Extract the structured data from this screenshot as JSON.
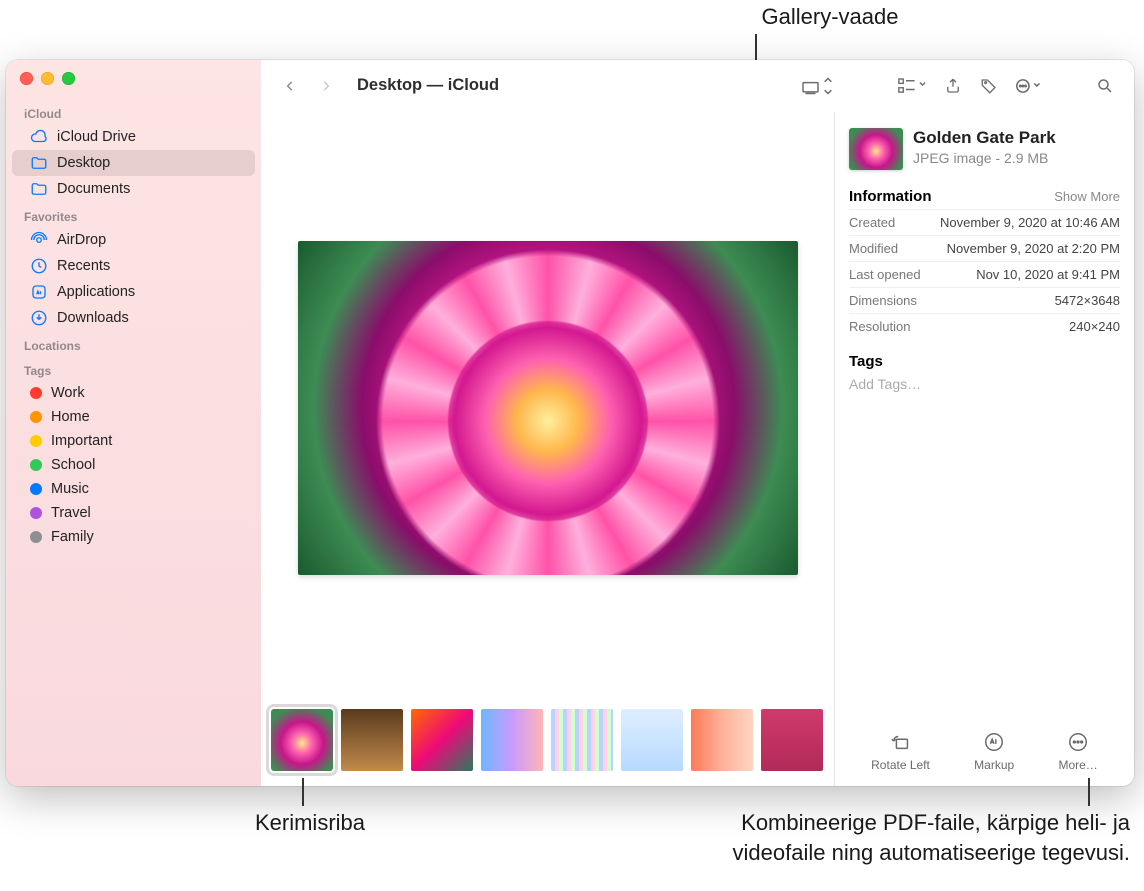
{
  "callouts": {
    "gallery_view": "Gallery-vaade",
    "scrubber": "Kerimisriba",
    "more_actions": "Kombineerige PDF-faile, kärpige heli- ja\nvideofaile ning automatiseerige tegevusi."
  },
  "window": {
    "title": "Desktop — iCloud"
  },
  "sidebar": {
    "sections": {
      "icloud": "iCloud",
      "favorites": "Favorites",
      "locations": "Locations",
      "tags_label": "Tags"
    },
    "icloud": [
      {
        "label": "iCloud Drive",
        "icon": "cloud"
      },
      {
        "label": "Desktop",
        "icon": "folder",
        "selected": true
      },
      {
        "label": "Documents",
        "icon": "folder"
      }
    ],
    "favorites": [
      {
        "label": "AirDrop",
        "icon": "airdrop"
      },
      {
        "label": "Recents",
        "icon": "clock"
      },
      {
        "label": "Applications",
        "icon": "app"
      },
      {
        "label": "Downloads",
        "icon": "download"
      }
    ],
    "tags": [
      {
        "label": "Work",
        "color": "#ff3b30"
      },
      {
        "label": "Home",
        "color": "#ff9500"
      },
      {
        "label": "Important",
        "color": "#ffcc00"
      },
      {
        "label": "School",
        "color": "#34c759"
      },
      {
        "label": "Music",
        "color": "#007aff"
      },
      {
        "label": "Travel",
        "color": "#af52de"
      },
      {
        "label": "Family",
        "color": "#8e8e93"
      }
    ]
  },
  "info": {
    "file_name": "Golden Gate Park",
    "file_meta": "JPEG image - 2.9 MB",
    "section_title": "Information",
    "show_more": "Show More",
    "rows": [
      {
        "label": "Created",
        "value": "November 9, 2020 at 10:46 AM"
      },
      {
        "label": "Modified",
        "value": "November 9, 2020 at 2:20 PM"
      },
      {
        "label": "Last opened",
        "value": "Nov 10, 2020 at 9:41 PM"
      },
      {
        "label": "Dimensions",
        "value": "5472×3648"
      },
      {
        "label": "Resolution",
        "value": "240×240"
      }
    ],
    "tags_title": "Tags",
    "tags_placeholder": "Add Tags…"
  },
  "actions": {
    "rotate_left": "Rotate Left",
    "markup": "Markup",
    "more": "More…"
  },
  "thumbs": [
    {
      "bg": "radial-gradient(circle at 50% 55%, #ffe98a 0%, #ff61b0 22%, #c7168a 46%, #3d8c53 80%)",
      "selected": true
    },
    {
      "bg": "linear-gradient(#5a3b1e,#c28a4a)"
    },
    {
      "bg": "linear-gradient(135deg,#ff6a00,#ee0979,#2a7a5f)"
    },
    {
      "bg": "linear-gradient(90deg,#6fb7ff,#c89aff,#ffb5b5)"
    },
    {
      "bg": "repeating-linear-gradient(90deg,#9be,#9be 4px,#fbe 4px,#fbe 8px,#bef 8px,#bef 12px)"
    },
    {
      "bg": "linear-gradient(#dfeeff,#b7d9ff)"
    },
    {
      "bg": "linear-gradient(90deg,#ff7a59,#ffb199,#ffd6c2)"
    },
    {
      "bg": "linear-gradient(#d03a6b,#b12a59)"
    }
  ]
}
